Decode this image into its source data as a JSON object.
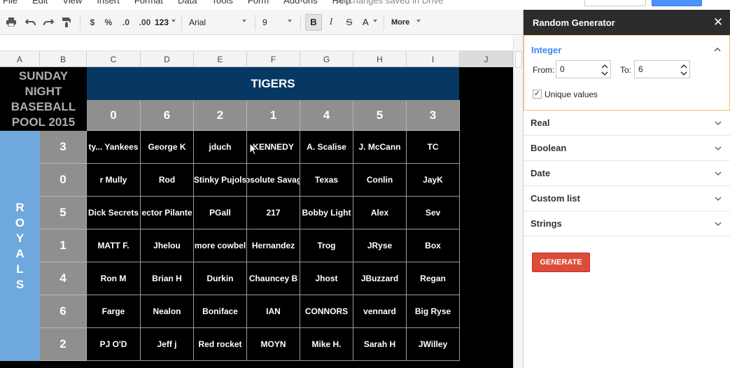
{
  "menu": {
    "items": [
      "File",
      "Edit",
      "View",
      "Insert",
      "Format",
      "Data",
      "Tools",
      "Form",
      "Add-ons",
      "Help"
    ],
    "saved_status": "All changes saved in Drive"
  },
  "toolbar": {
    "currency": "$",
    "percent": "%",
    "dec_less": ".0",
    "dec_more": ".00",
    "format_more": "123",
    "font": "Arial",
    "font_size": "9",
    "bold": "B",
    "italic": "I",
    "strike": "S",
    "text_color": "A",
    "more": "More"
  },
  "columns": [
    "A",
    "B",
    "C",
    "D",
    "E",
    "F",
    "G",
    "H",
    "I",
    "J"
  ],
  "sheet": {
    "title_lines": [
      "SUNDAY",
      "NIGHT",
      "BASEBALL",
      "POOL 2015"
    ],
    "top_team": "TIGERS",
    "side_team_letters": [
      "R",
      "O",
      "Y",
      "A",
      "L",
      "S"
    ],
    "top_digits": [
      "0",
      "6",
      "2",
      "1",
      "4",
      "5",
      "3"
    ],
    "side_digits": [
      "3",
      "0",
      "5",
      "1",
      "4",
      "6",
      "2"
    ],
    "rows": [
      [
        "ty... Yankees",
        "George K",
        "jduch",
        "KENNEDY",
        "A. Scalise",
        "J. McCann",
        "TC"
      ],
      [
        "r Mully",
        "Rod",
        "Stinky Pujols",
        "bsolute Savag",
        "Texas",
        "Conlin",
        "JayK"
      ],
      [
        "Dick Secrets",
        "ector Pilante",
        "PGall",
        "217",
        "Bobby Light",
        "Alex",
        "Sev"
      ],
      [
        "MATT F.",
        "Jhelou",
        "more cowbel",
        "Hernandez",
        "Trog",
        "JRyse",
        "Box"
      ],
      [
        "Ron M",
        "Brian H",
        "Durkin",
        "Chauncey B",
        "Jhost",
        "JBuzzard",
        "Regan"
      ],
      [
        "Farge",
        "Nealon",
        "Boniface",
        "IAN",
        "CONNORS",
        "vennard",
        "Big Ryse"
      ],
      [
        "PJ O'D",
        "Jeff j",
        "Red rocket",
        "MOYN",
        "Mike H.",
        "Sarah H",
        "JWilley"
      ]
    ]
  },
  "panel": {
    "title": "Random Generator",
    "integer": {
      "title": "Integer",
      "from_label": "From:",
      "from_value": "0",
      "to_label": "To:",
      "to_value": "6",
      "unique_label": "Unique values",
      "unique_checked": true
    },
    "sections": [
      "Real",
      "Boolean",
      "Date",
      "Custom list",
      "Strings"
    ],
    "generate_label": "GENERATE"
  },
  "colors": {
    "tigers_bg": "#073763",
    "royals_bg": "#6fa8dc",
    "digit_bg": "#8f8f8f",
    "generate_bg": "#dd4b39",
    "accent": "#4285f4"
  }
}
